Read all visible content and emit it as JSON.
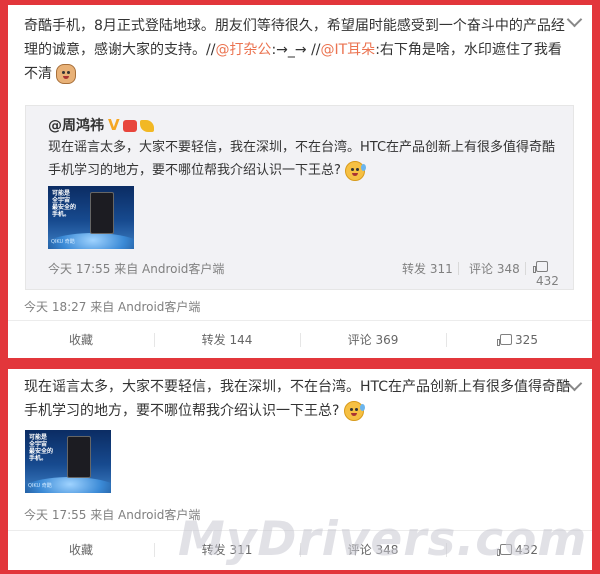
{
  "post1": {
    "text_plain": "奇酷手机，8月正式登陆地球。朋友们等待很久，希望届时能感受到一个奋斗中的产品经理的诚意，感谢大家的支持。//",
    "mention1": "@打杂公",
    "arrow1": ":→_→ //",
    "mention2": "@IT耳朵",
    "text_tail": ":右下角是啥，水印遮住了我看不清",
    "emoji1": "dog-emoji",
    "quote": {
      "author": "@周鸿祎",
      "verified": "V",
      "text": "现在谣言太多，大家不要轻信，我在深圳，不在台湾。HTC在产品创新上有很多值得奇酷手机学习的地方，要不哪位帮我介绍认识一下王总?",
      "emoji": "nervous-emoji",
      "image": {
        "slogan": "可能是\n全宇宙\n最安全的\n手机。",
        "brand": "QIKU 奇酷"
      },
      "time": "今天 17:55 来自 Android客户端",
      "repost": "转发 311",
      "comment": "评论 348",
      "likes": "432"
    },
    "time": "今天 18:27 来自 Android客户端",
    "actions": {
      "favorite": "收藏",
      "repost": "转发 144",
      "comment": "评论 369",
      "likes": "325"
    }
  },
  "post2": {
    "text": "现在谣言太多，大家不要轻信，我在深圳，不在台湾。HTC在产品创新上有很多值得奇酷手机学习的地方，要不哪位帮我介绍认识一下王总?",
    "emoji": "nervous-emoji",
    "image": {
      "slogan": "可能是\n全宇宙\n最安全的\n手机。",
      "brand": "QIKU 奇酷"
    },
    "time": "今天 17:55 来自 Android客户端",
    "actions": {
      "favorite": "收藏",
      "repost": "转发 311",
      "comment": "评论 348",
      "likes": "432"
    }
  },
  "watermark": "MyDrivers.com",
  "colors": {
    "background": "#e2363b",
    "link": "#eb7350",
    "muted": "#808080"
  }
}
